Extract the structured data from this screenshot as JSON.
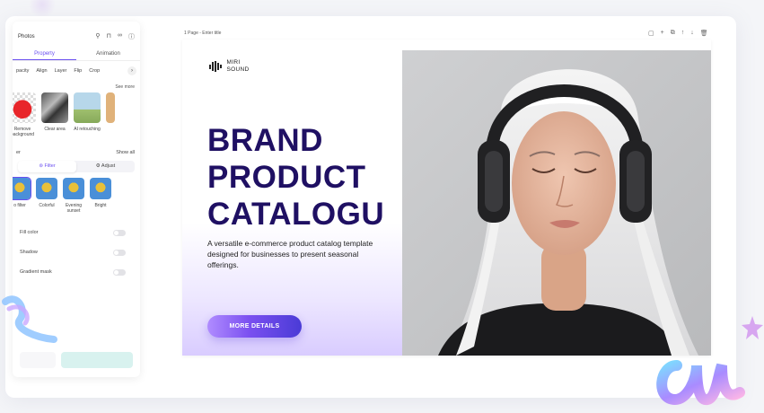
{
  "panel": {
    "title": "Photos",
    "tabs": [
      "Property",
      "Animation"
    ],
    "subtabs": [
      "pacity",
      "Align",
      "Layer",
      "Flip",
      "Crop"
    ],
    "see_more": "See more",
    "tools": [
      {
        "label": "Remove background",
        "icon": "apple-thumb"
      },
      {
        "label": "Clear area",
        "icon": "clear-thumb"
      },
      {
        "label": "AI retouching",
        "icon": "ai-thumb"
      }
    ],
    "filter_heading": "er",
    "show_all": "Show all",
    "filter_tab": "Filter",
    "adjust_tab": "Adjust",
    "filters": [
      "o filter",
      "Colorful",
      "Evening sunset",
      "Bright"
    ],
    "options": [
      "Fill color",
      "Shadow",
      "Gradient mask"
    ]
  },
  "canvas": {
    "page_label": "1 Page - Enter title",
    "logo_line1": "MIRI",
    "logo_line2": "SOUND",
    "headline": [
      "BRAND",
      "PRODUCT",
      "CATALOGU"
    ],
    "subcopy": "A versatile e-commerce product catalog template designed for businesses to present seasonal offerings.",
    "cta": "MORE DETAILS"
  },
  "colors": {
    "accent": "#6a4ff0",
    "headline": "#1f1063",
    "cta_start": "#b08cff",
    "cta_end": "#4a3bd6"
  }
}
